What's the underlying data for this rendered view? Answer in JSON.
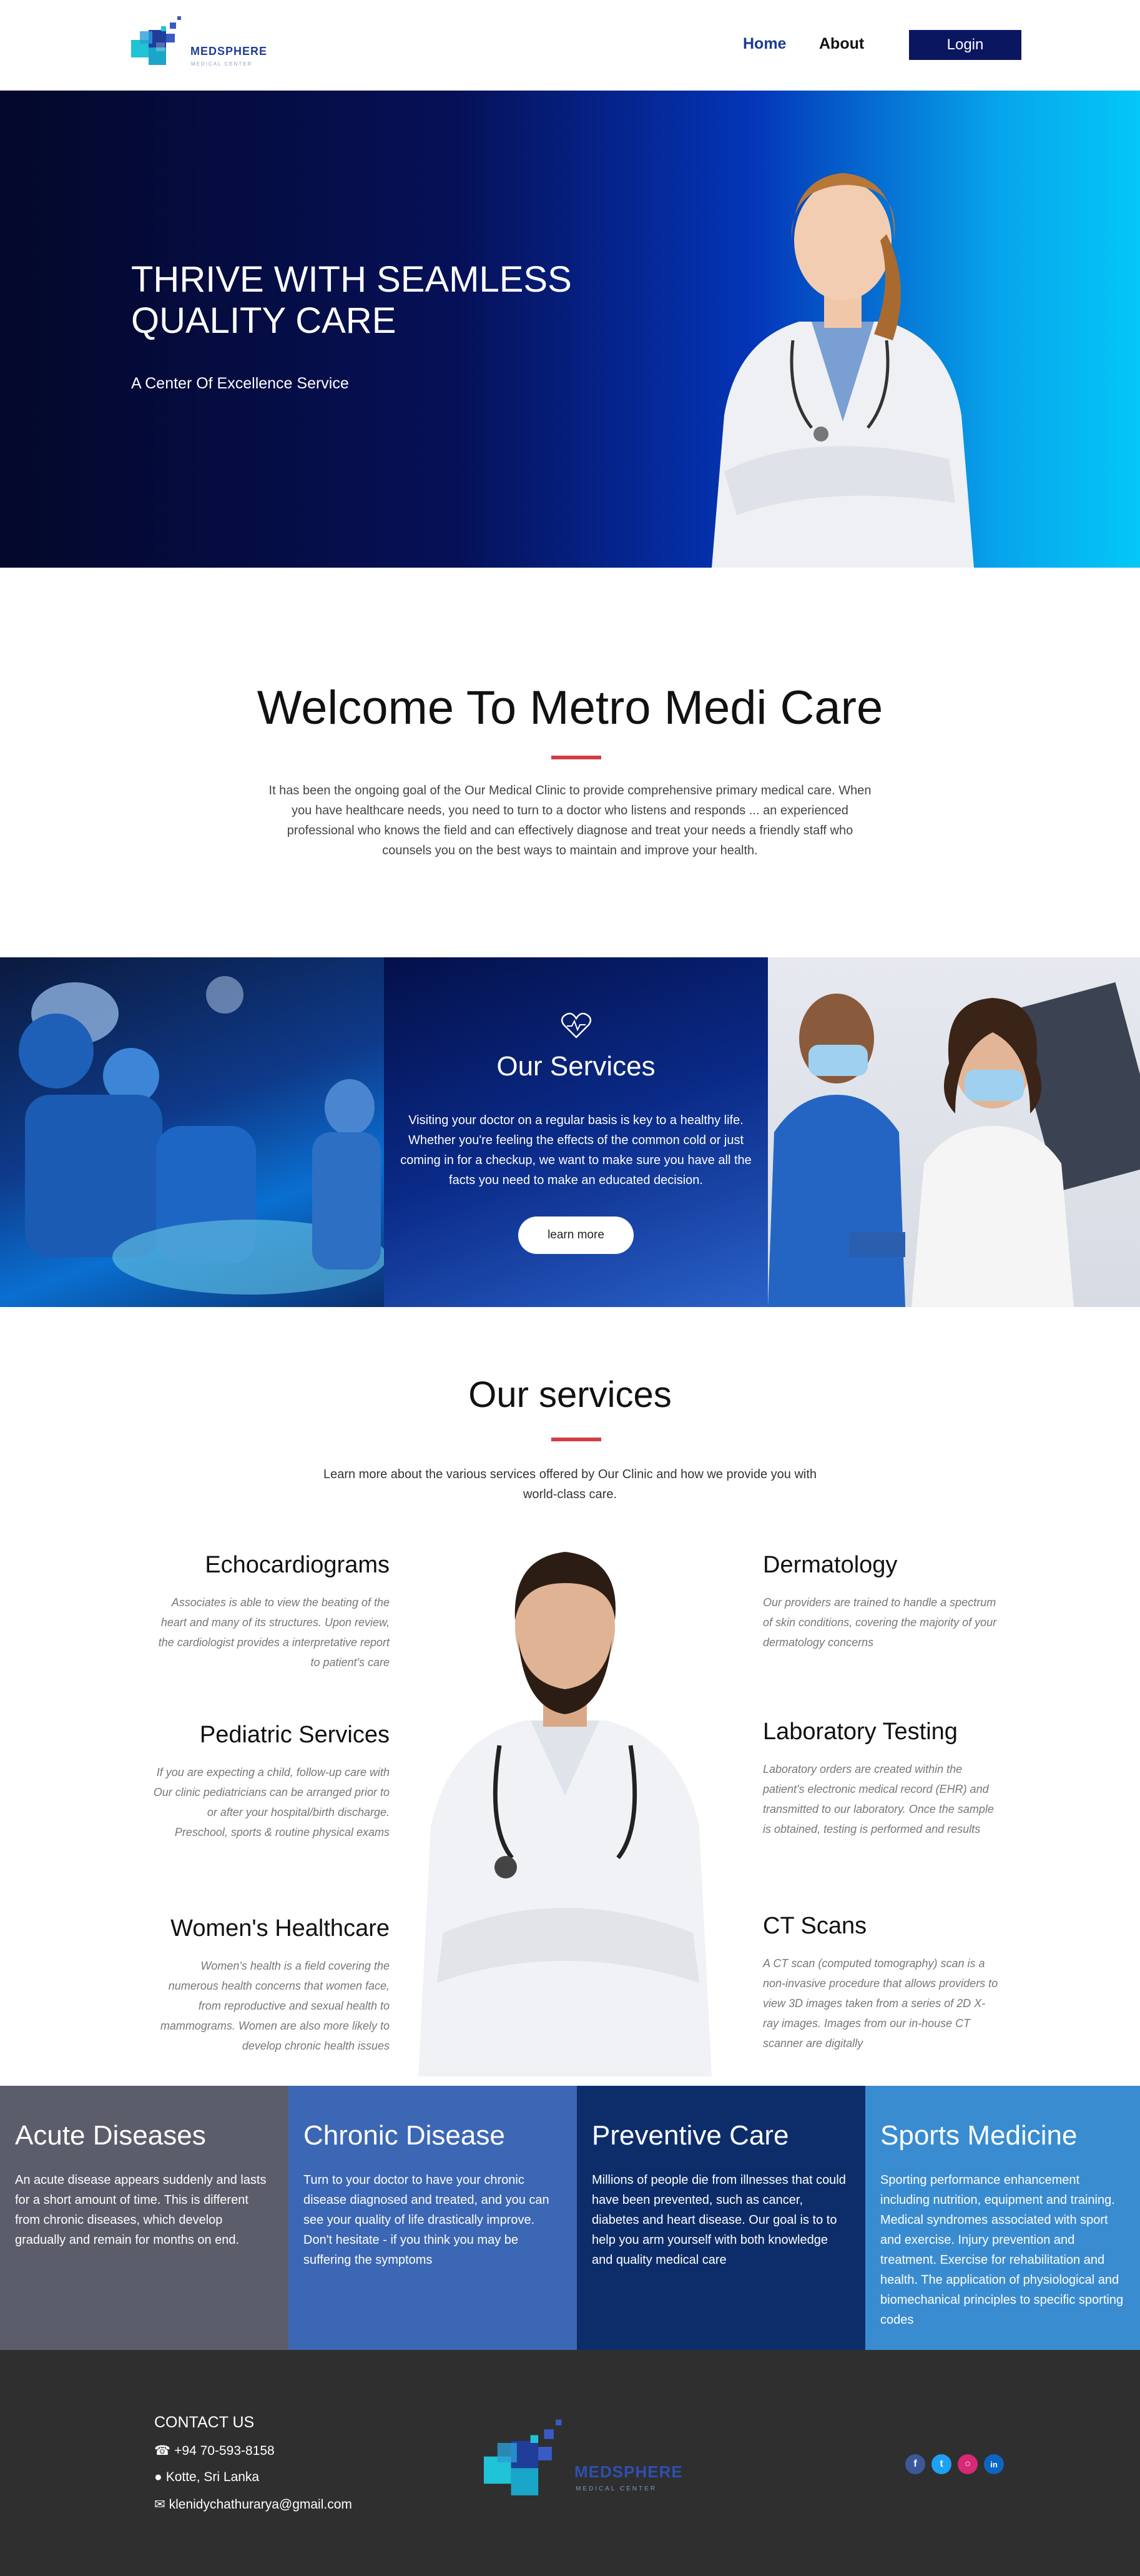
{
  "nav": {
    "logo_name": "MEDSPHERE",
    "logo_tagline": "MEDICAL CENTER",
    "home": "Home",
    "about": "About",
    "login": "Login"
  },
  "hero": {
    "title": "THRIVE WITH SEAMLESS QUALITY CARE",
    "subtitle": "A Center Of Excellence Service"
  },
  "welcome": {
    "title": "Welcome To Metro Medi Care",
    "text": "It has been the ongoing goal of the Our Medical Clinic to provide comprehensive primary medical care. When you have healthcare needs, you need to turn to a doctor who listens and responds ... an experienced professional who knows the field and can effectively diagnose and treat your needs a friendly staff who counsels you on the best ways to maintain and improve your health."
  },
  "banner": {
    "title": "Our Services",
    "text": "Visiting your doctor on a regular basis is key to a healthy life. Whether you're feeling the effects of the common cold or just coming in for a checkup, we want to make sure you have all the facts you need to make an educated decision.",
    "button": "learn more"
  },
  "our_services": {
    "title": "Our services",
    "text": "Learn more about the various services offered by Our Clinic and how we provide you with world-class care.",
    "items": [
      {
        "title": "Echocardiograms",
        "text": "Associates is able to view the beating of the heart and many of its structures. Upon review, the cardiologist provides a interpretative report to patient's care"
      },
      {
        "title": "Pediatric Services",
        "text": "If you are expecting a child, follow-up care with Our clinic pediatricians can be arranged prior to or after your hospital/birth discharge. Preschool, sports & routine physical exams"
      },
      {
        "title": "Women's Healthcare",
        "text": "Women's health is a field covering the numerous health concerns that women face, from reproductive and sexual health to mammograms. Women are also more likely to develop chronic health issues"
      },
      {
        "title": "Dermatology",
        "text": "Our providers are trained to handle a spectrum of skin conditions, covering the majority of your dermatology concerns"
      },
      {
        "title": "Laboratory Testing",
        "text": "Laboratory orders are created within the patient's electronic medical record (EHR) and transmitted to our laboratory. Once the sample is obtained, testing is performed and results"
      },
      {
        "title": "CT Scans",
        "text": "A CT scan (computed tomography) scan is a non-invasive procedure that allows providers to view 3D images taken from a series of 2D X-ray images. Images from our in-house CT scanner are digitally"
      }
    ]
  },
  "columns": [
    {
      "title": "Acute Diseases",
      "text": "An acute disease appears suddenly and lasts for a short amount of time. This is different from chronic diseases, which develop gradually and remain for months on end.",
      "color": "#5b5d6b"
    },
    {
      "title": "Chronic Disease",
      "text": "Turn to your doctor to have your chronic disease diagnosed and treated, and you can see your quality of life drastically improve. Don't hesitate - if you think you may be suffering the symptoms",
      "color": "#3c67b4"
    },
    {
      "title": "Preventive Care",
      "text": "Millions of people die from illnesses that could have been prevented, such as cancer, diabetes and heart disease. Our goal is to to help you arm yourself with both knowledge and quality medical care",
      "color": "#0d2d6a"
    },
    {
      "title": "Sports Medicine",
      "text": "Sporting performance enhancement including nutrition, equipment and training. Medical syndromes associated with sport and exercise. Injury prevention and treatment. Exercise for rehabilitation and health. The application of physiological and biomechanical principles to specific sporting codes",
      "color": "#3a8cd1"
    }
  ],
  "footer": {
    "heading": "CONTACT US",
    "phone": "+94 70-593-8158",
    "location": "Kotte, Sri Lanka",
    "email": "klenidychathurarya@gmail.com",
    "logo_name": "MEDSPHERE",
    "logo_tagline": "MEDICAL CENTER",
    "socials": [
      "facebook-icon",
      "twitter-icon",
      "instagram-icon",
      "linkedin-icon"
    ]
  },
  "colors": {
    "navy": "#0a1660",
    "accent_red": "#d23c44",
    "brand_blue": "#1f3d99",
    "teal": "#22c4d6"
  }
}
